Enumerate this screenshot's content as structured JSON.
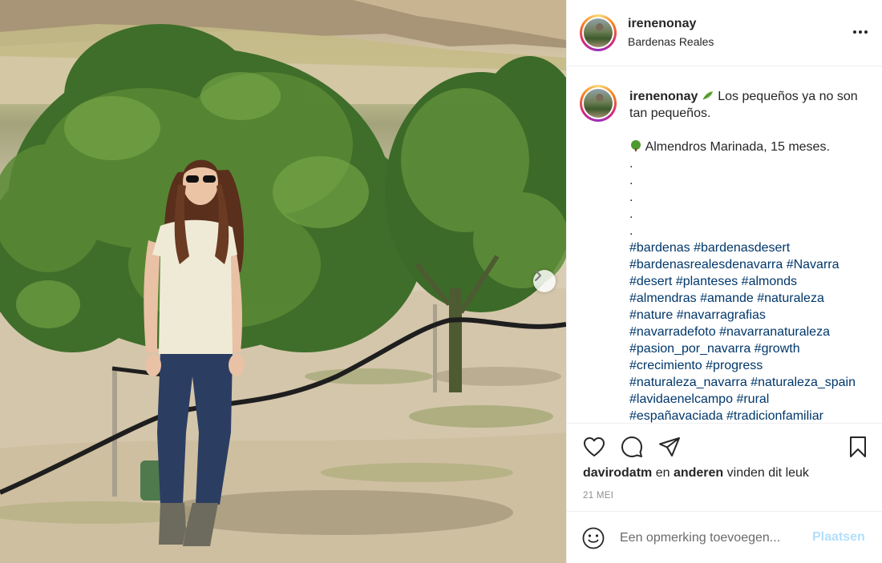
{
  "post": {
    "username": "irenenonay",
    "location": "Bardenas Reales",
    "caption": {
      "username": "irenenonay",
      "first_line": " Los pequeños ya no son tan pequeños.",
      "second_line": " Almendros Marinada, 15 meses.",
      "dots": [
        ".",
        ".",
        ".",
        ".",
        "."
      ],
      "hashtag_lines": [
        [
          "#bardenas",
          "#bardenasdesert"
        ],
        [
          "#bardenasrealesdenavarra",
          "#Navarra"
        ],
        [
          "#desert",
          "#planteses",
          "#almonds"
        ],
        [
          "#almendras",
          "#amande",
          "#naturaleza"
        ],
        [
          "#nature",
          "#navarragrafias"
        ],
        [
          "#navarradefoto",
          "#navarranaturaleza"
        ],
        [
          "#pasion_por_navarra",
          "#growth"
        ],
        [
          "#crecimiento",
          "#progress"
        ],
        [
          "#naturaleza_navarra",
          "#naturaleza_spain"
        ],
        [
          "#lavidaenelcampo",
          "#rural"
        ],
        [
          "#españavaciada",
          "#tradicionfamiliar"
        ]
      ]
    },
    "likes": {
      "user": "davirodatm",
      "connector": " en ",
      "others": "anderen",
      "suffix": " vinden dit leuk"
    },
    "date": "21 MEI",
    "comment": {
      "placeholder": "Een opmerking toevoegen...",
      "post_label": "Plaatsen"
    }
  },
  "icons": {
    "more": "more-options-icon",
    "like": "heart-icon",
    "comment": "comment-icon",
    "share": "paper-plane-icon",
    "save": "bookmark-icon",
    "emoji": "emoji-icon",
    "next": "chevron-right-icon",
    "caption_emoji_1": "herb-leaf-emoji",
    "caption_emoji_2": "tree-emoji"
  },
  "colors": {
    "text": "#262626",
    "hashtag": "#00376b",
    "secondary": "#8e8e8e",
    "post_button_disabled": "#b2dffc",
    "divider": "#efefef"
  }
}
